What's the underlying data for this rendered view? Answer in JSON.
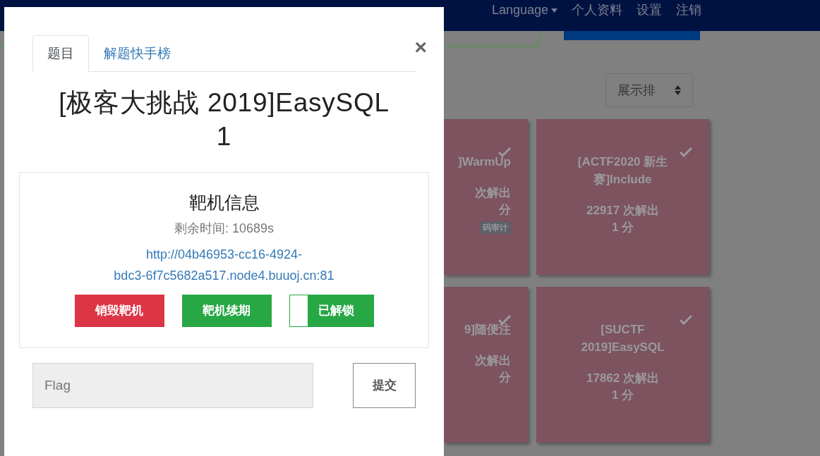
{
  "nav": {
    "right_items": [
      {
        "label": "Language",
        "dropdown": true
      },
      {
        "label": "个人资料",
        "dropdown": false
      },
      {
        "label": "设置",
        "dropdown": false
      },
      {
        "label": "注销",
        "dropdown": false
      }
    ]
  },
  "sort_select": {
    "value": "展示排"
  },
  "cards": [
    {
      "partial": true,
      "solved": true,
      "title": "]WarmUp",
      "solves": "次解出",
      "points": "分",
      "tag": "码审计"
    },
    {
      "partial": false,
      "solved": true,
      "title": "[ACTF2020 新生赛]Include",
      "solves": "22917 次解出",
      "points": "1 分"
    },
    {
      "partial": true,
      "solved": true,
      "title": "9]随便注",
      "solves": "次解出",
      "points": "分"
    },
    {
      "partial": false,
      "solved": true,
      "title": "[SUCTF 2019]EasySQL",
      "solves": "17862 次解出",
      "points": "1 分"
    }
  ],
  "modal": {
    "tabs": [
      {
        "label": "题目",
        "selected": true
      },
      {
        "label": "解题快手榜",
        "selected": false
      }
    ],
    "close": "×",
    "title": "[极客大挑战 2019]EasySQL 1",
    "instance": {
      "heading": "靶机信息",
      "remaining": "剩余时间: 10689s",
      "url": "http://04b46953-cc16-4924-bdc3-6f7c5682a517.node4.buuoj.cn:81",
      "buttons": [
        {
          "label": "销毁靶机",
          "kind": "danger"
        },
        {
          "label": "靶机续期",
          "kind": "success"
        },
        {
          "label": "已解锁",
          "kind": "switch",
          "on": true
        }
      ]
    },
    "flag": {
      "placeholder": "Flag"
    },
    "submit": "提交"
  }
}
